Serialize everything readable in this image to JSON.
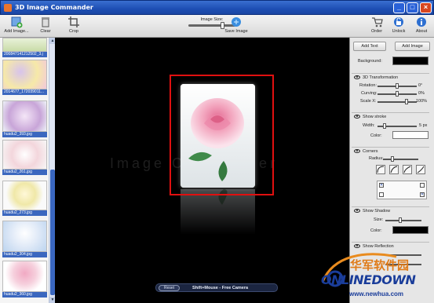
{
  "window": {
    "title": "3D Image Commander"
  },
  "toolbar": {
    "add_image": "Add Image...",
    "clear": "Clear",
    "crop": "Crop",
    "image_size_label": "Image Size:",
    "image_size_value": 0.7,
    "save_image": "Save Image",
    "order": "Order",
    "unlock": "Unlock",
    "about": "About"
  },
  "thumbnails": [
    {
      "caption": "200847141212502_3.j"
    },
    {
      "caption": "2014677_172039011..."
    },
    {
      "caption": "huadu2_393.jpg"
    },
    {
      "caption": "huadu2_261.jpg"
    },
    {
      "caption": "huadu2_273.jpg"
    },
    {
      "caption": "huadu2_304.jpg"
    },
    {
      "caption": "huadu2_360.jpg"
    }
  ],
  "canvas": {
    "watermark": "Image Commander",
    "reset": "Reset",
    "hint": "Shift+Mouse - Free Camera"
  },
  "panel": {
    "add_text": "Add Text",
    "add_image": "Add Image",
    "background_label": "Background:",
    "background_color": "#000000",
    "transformation": {
      "title": "3D Transformation",
      "rotation_label": "Rotation:",
      "rotation_value": "0°",
      "curving_label": "Curving:",
      "curving_value": "0%",
      "scale_label": "Scale X:",
      "scale_value": "100%"
    },
    "stroke": {
      "title": "Show stroke",
      "width_label": "Width:",
      "width_value": "5 px",
      "color_label": "Color:"
    },
    "corners": {
      "title": "Corners",
      "radius_label": "Radius:"
    },
    "shadow": {
      "title": "Show Shadow",
      "size_label": "Size:",
      "color_label": "Color:"
    },
    "reflection": {
      "title": "Show Reflection"
    }
  },
  "logo": {
    "chinese": "华军软件园",
    "english": "ONLINEDOWN",
    "url": "www.newhua.com"
  },
  "colors": {
    "accent": "#3b67bf",
    "selection": "#e01010",
    "titlebar": "#1e4fb4"
  }
}
